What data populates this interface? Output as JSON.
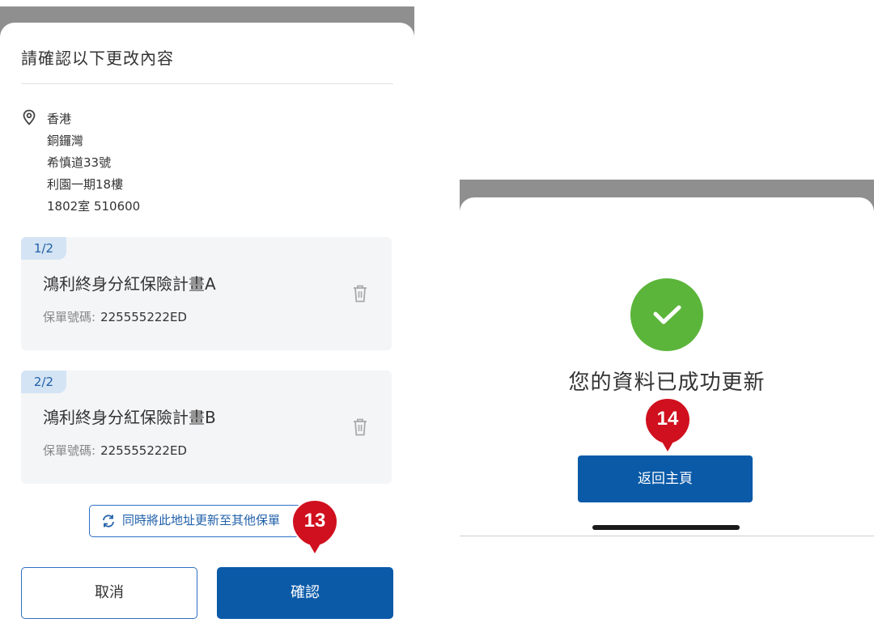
{
  "confirm_sheet": {
    "title": "請確認以下更改內容",
    "address_lines": [
      "香港",
      "銅鑼灣",
      "希慎道33號",
      "利園一期18樓",
      "1802室 510600"
    ],
    "policies": [
      {
        "index": "1/2",
        "name": "鴻利終身分紅保險計畫A",
        "policy_label": "保單號碼:",
        "policy_number": "225555222ED"
      },
      {
        "index": "2/2",
        "name": "鴻利終身分紅保險計畫B",
        "policy_label": "保單號碼:",
        "policy_number": "225555222ED"
      }
    ],
    "sync_button_label": "同時將此地址更新至其他保單",
    "cancel_label": "取消",
    "confirm_label": "確認"
  },
  "success_sheet": {
    "message": "您的資料已成功更新",
    "home_button_label": "返回主頁"
  },
  "step_markers": [
    "13",
    "14"
  ],
  "icons": [
    "location-pin-icon",
    "trash-icon",
    "sync-icon",
    "checkmark-icon"
  ],
  "colors": {
    "primary": "#0a5aa8",
    "marker": "#d0101e",
    "success": "#5bb53a",
    "badge_bg": "#d4e4f4"
  }
}
